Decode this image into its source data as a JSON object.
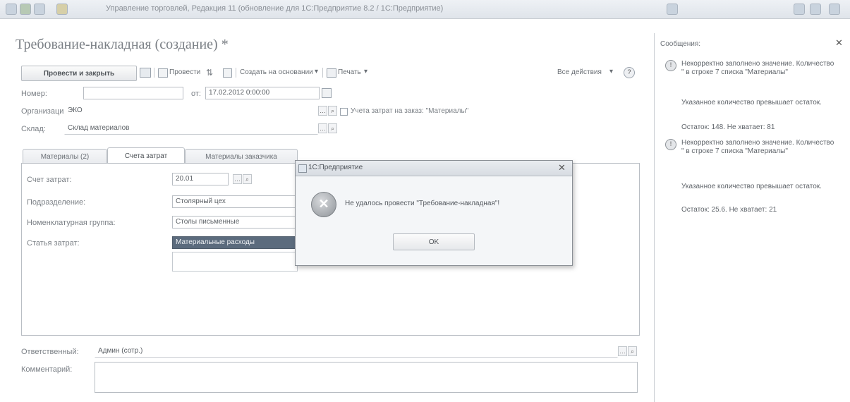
{
  "window": {
    "title": "Управление торговлей, Редакция 11 (обновление для 1С:Предприятие 8.2 / 1С:Предприятие)"
  },
  "form": {
    "title": "Требование-накладная (создание) *",
    "toolbar": {
      "post_close": "Провести и закрыть",
      "post": "Провести",
      "create_based_on": "Создать на основании",
      "print": "Печать",
      "all_actions": "Все действия"
    },
    "number_label": "Номер:",
    "number_value": "",
    "date_from_label": "от:",
    "date_value": "17.02.2012 0:00:00",
    "organization_label": "Организация:",
    "organization_value": "ЭКО",
    "cost_accounting_label": "Учета затрат на заказ: \"Материалы\"",
    "warehouse_label": "Склад:",
    "warehouse_value": "Склад материалов",
    "tabs": [
      {
        "label": "Материалы (2)"
      },
      {
        "label": "Счета затрат"
      },
      {
        "label": "Материалы заказчика"
      }
    ],
    "cost_account_label": "Счет затрат:",
    "cost_account_value": "20.01",
    "division_label": "Подразделение:",
    "division_value": "Столярный цех",
    "cost_item_label": "Номенклатурная группа:",
    "cost_item_value": "Столы письменные",
    "expense_item_label": "Статья затрат:",
    "expense_item_value": "Материальные расходы",
    "responsible_label": "Ответственный:",
    "responsible_value": "Админ (сотр.)",
    "comment_label": "Комментарий:",
    "comment_value": ""
  },
  "dialog": {
    "title": "1С:Предприятие",
    "message": "Не удалось провести \"Требование-накладная\"!",
    "ok_label": "OK"
  },
  "messages": {
    "title": "Сообщения:",
    "items": [
      {
        "text": "Некорректно заполнено значение. Количество \" в строке 7 списка \"Материалы\"",
        "detail": "Указанное количество превышает остаток.",
        "balance": "Остаток: 148. Не хватает: 81"
      },
      {
        "text": "Некорректно заполнено значение. Количество \" в строке 7 списка \"Материалы\"",
        "detail": "Указанное количество превышает остаток.",
        "balance": "Остаток: 25.6. Не хватает: 21"
      }
    ]
  },
  "icons": {
    "error": "error-icon",
    "message_info": "info-icon",
    "close": "close-icon"
  },
  "colors": {
    "accent_selection": "#5b6b7d",
    "title_text": "#7a7f85"
  }
}
